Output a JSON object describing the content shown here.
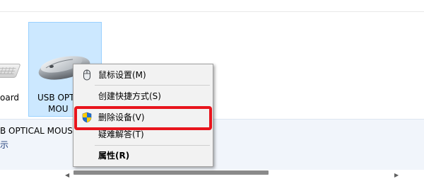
{
  "devices": [
    {
      "label_line1": "oard",
      "label_line2": ""
    },
    {
      "label_line1": "USB OPT",
      "label_line2": "MOU",
      "selected": true
    }
  ],
  "details": {
    "name": "B OPTICAL MOUS",
    "status": "示"
  },
  "context_menu": {
    "items": [
      {
        "label": "鼠标设置(M)",
        "icon": "mouse-icon"
      },
      {
        "label": "创建快捷方式(S)"
      },
      {
        "label": "删除设备(V)",
        "icon": "uac-shield-icon",
        "highlighted": true
      },
      {
        "label": "疑难解答(T)"
      },
      {
        "label": "属性(R)",
        "bold": true
      }
    ]
  },
  "scrollbar": {
    "left_arrow": "◀",
    "right_arrow": "▶"
  },
  "colors": {
    "selection_bg": "#cce8ff",
    "selection_border": "#99d1ff",
    "menu_bg": "#f2f2f2",
    "highlight_border": "#e8141c",
    "details_bg": "#f1f5fb"
  }
}
